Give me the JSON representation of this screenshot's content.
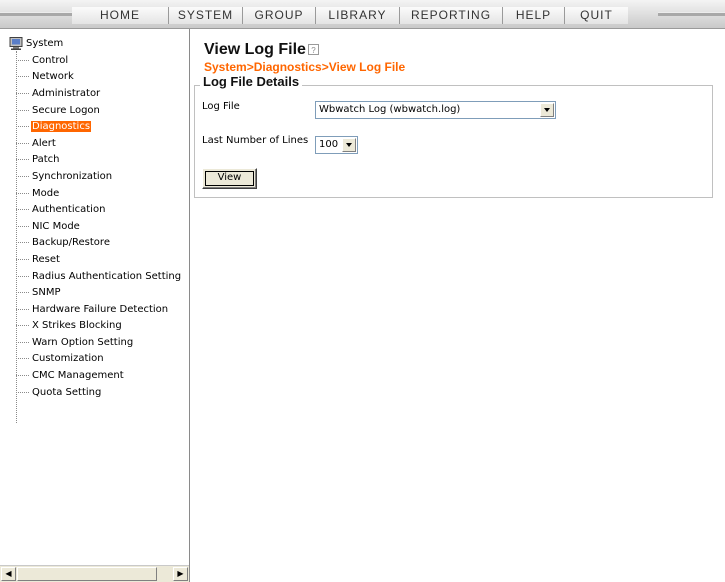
{
  "menu": {
    "items": [
      {
        "label": "HOME"
      },
      {
        "label": "SYSTEM"
      },
      {
        "label": "GROUP"
      },
      {
        "label": "LIBRARY"
      },
      {
        "label": "REPORTING"
      },
      {
        "label": "HELP"
      },
      {
        "label": "QUIT"
      }
    ]
  },
  "tree": {
    "root": "System",
    "items": [
      {
        "label": "Control"
      },
      {
        "label": "Network"
      },
      {
        "label": "Administrator"
      },
      {
        "label": "Secure Logon"
      },
      {
        "label": "Diagnostics",
        "selected": true
      },
      {
        "label": "Alert"
      },
      {
        "label": "Patch"
      },
      {
        "label": "Synchronization"
      },
      {
        "label": "Mode"
      },
      {
        "label": "Authentication"
      },
      {
        "label": "NIC Mode"
      },
      {
        "label": "Backup/Restore"
      },
      {
        "label": "Reset"
      },
      {
        "label": "Radius Authentication Setting"
      },
      {
        "label": "SNMP"
      },
      {
        "label": "Hardware Failure Detection"
      },
      {
        "label": "X Strikes Blocking"
      },
      {
        "label": "Warn Option Setting"
      },
      {
        "label": "Customization"
      },
      {
        "label": "CMC Management"
      },
      {
        "label": "Quota Setting"
      }
    ]
  },
  "page": {
    "title": "View Log File",
    "breadcrumb": "System>Diagnostics>View Log File",
    "section_title": "Log File Details",
    "log_file": {
      "label": "Log File",
      "value": "Wbwatch Log (wbwatch.log)"
    },
    "lines": {
      "label": "Last Number of Lines",
      "value": "100"
    },
    "view_button": "View"
  },
  "colors": {
    "accent": "#ff6600",
    "selected_bg": "#ff6600"
  }
}
